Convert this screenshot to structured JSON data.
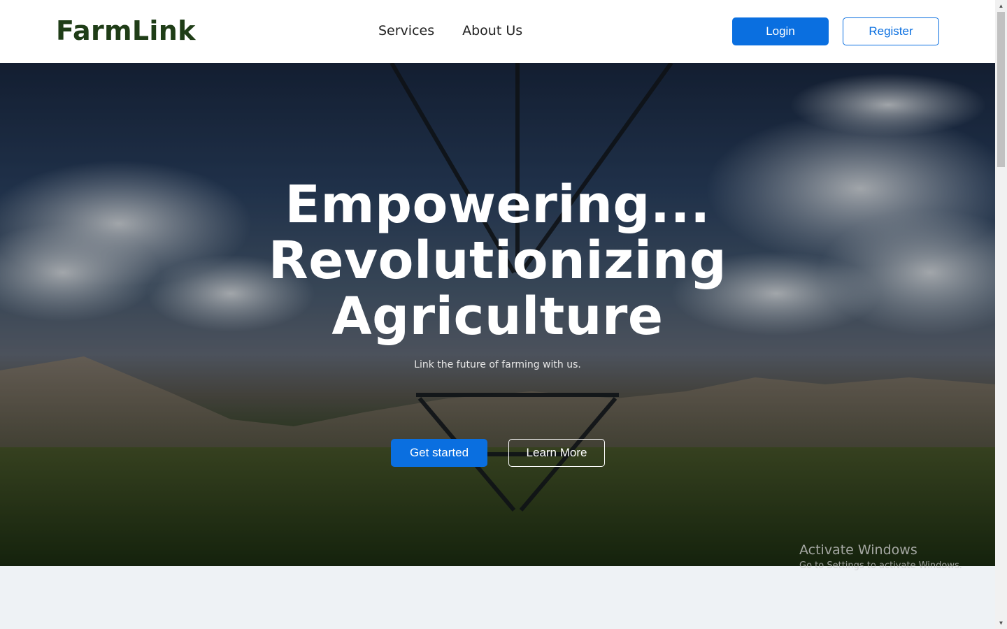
{
  "header": {
    "logo": "FarmLink",
    "nav": [
      "Services",
      "About Us"
    ],
    "login_label": "Login",
    "register_label": "Register"
  },
  "hero": {
    "title_lines": [
      "Empowering...",
      "Revolutionizing",
      "Agriculture"
    ],
    "subtitle": "Link the future of farming with us.",
    "primary_cta": "Get started",
    "secondary_cta": "Learn More"
  },
  "watermark": {
    "title": "Activate Windows",
    "subtitle": "Go to Settings to activate Windows."
  },
  "colors": {
    "accent": "#0a6fe0",
    "logo": "#1f3d17",
    "section_bg": "#eef2f5"
  },
  "icons": {
    "scroll_up": "chevron-up-icon",
    "scroll_down": "chevron-down-icon"
  }
}
